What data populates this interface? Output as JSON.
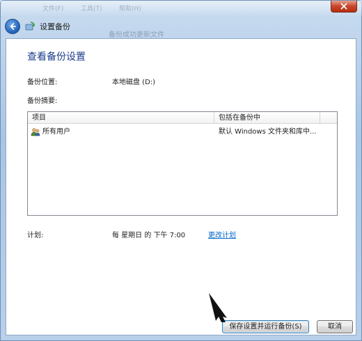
{
  "window": {
    "title": "设置备份",
    "blurred_title_text": "备份成功更新文件",
    "blurred_menu_1": "文件(F)",
    "blurred_menu_2": "工具(T)",
    "blurred_menu_3": "帮助(H)"
  },
  "main": {
    "heading": "查看备份设置",
    "backup_location_label": "备份位置:",
    "backup_location_value": "本地磁盘 (D:)",
    "backup_summary_label": "备份摘要:",
    "table": {
      "columns": [
        "项目",
        "包括在备份中"
      ],
      "rows": [
        {
          "item": "所有用户",
          "included": "默认 Windows 文件夹和库中..."
        }
      ]
    },
    "schedule_label": "计划:",
    "schedule_value": "每 星期日 的 下午 7:00",
    "change_schedule_link": "更改计划"
  },
  "footer": {
    "save_run_button": "保存设置并运行备份(S)",
    "save_run_button_visible": "保存  设置并运行备份(S)",
    "cancel_button": "取消"
  },
  "icons": {
    "back": "back-arrow-icon",
    "app": "backup-icon",
    "users": "users-icon",
    "close": "close-icon"
  },
  "colors": {
    "heading": "#1c3d8f",
    "link": "#0066cc",
    "close": "#c9452a"
  }
}
